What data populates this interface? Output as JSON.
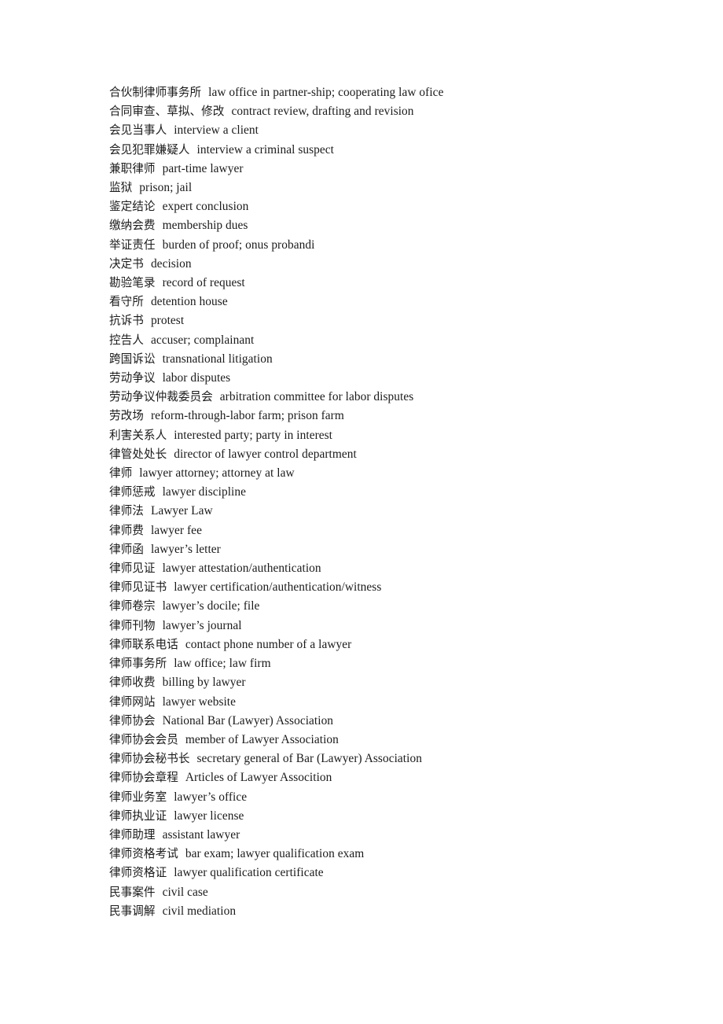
{
  "document": {
    "type": "bilingual-glossary",
    "language_pair": "Chinese-English",
    "subject": "legal terminology",
    "background_color": "#ffffff",
    "text_color": "#1b1b1b",
    "entry_count": 42
  },
  "entries": [
    {
      "term": "合伙制律师事务所",
      "gloss": "law office in partner-ship; cooperating law ofice"
    },
    {
      "term": "合同审查、草拟、修改",
      "gloss": "contract review, drafting and revision"
    },
    {
      "term": "会见当事人",
      "gloss": "interview a client"
    },
    {
      "term": "会见犯罪嫌疑人",
      "gloss": "interview a criminal suspect"
    },
    {
      "term": "兼职律师",
      "gloss": "part-time lawyer"
    },
    {
      "term": "监狱",
      "gloss": "prison; jail"
    },
    {
      "term": "鉴定结论",
      "gloss": "expert conclusion"
    },
    {
      "term": "缴纳会费",
      "gloss": "membership dues"
    },
    {
      "term": "举证责任",
      "gloss": "burden of proof; onus probandi"
    },
    {
      "term": "决定书",
      "gloss": "decision"
    },
    {
      "term": "勘验笔录",
      "gloss": "record of request"
    },
    {
      "term": "看守所",
      "gloss": "detention house"
    },
    {
      "term": "抗诉书",
      "gloss": "protest"
    },
    {
      "term": "控告人",
      "gloss": "accuser; complainant"
    },
    {
      "term": "跨国诉讼",
      "gloss": "transnational litigation"
    },
    {
      "term": "劳动争议",
      "gloss": "labor disputes"
    },
    {
      "term": "劳动争议仲裁委员会",
      "gloss": "arbitration committee for labor disputes"
    },
    {
      "term": "劳改场",
      "gloss": "reform-through-labor farm; prison farm"
    },
    {
      "term": "利害关系人",
      "gloss": "interested party; party in interest"
    },
    {
      "term": "律管处处长",
      "gloss": "director of lawyer control department"
    },
    {
      "term": "律师",
      "gloss": "lawyer attorney; attorney at law"
    },
    {
      "term": "律师惩戒",
      "gloss": "lawyer discipline"
    },
    {
      "term": "律师法",
      "gloss": "Lawyer Law"
    },
    {
      "term": "律师费",
      "gloss": "lawyer fee"
    },
    {
      "term": "律师函",
      "gloss": "lawyer’s letter"
    },
    {
      "term": "律师见证",
      "gloss": "lawyer attestation/authentication"
    },
    {
      "term": "律师见证书",
      "gloss": "lawyer certification/authentication/witness"
    },
    {
      "term": "律师卷宗",
      "gloss": "lawyer’s docile; file"
    },
    {
      "term": "律师刊物",
      "gloss": "lawyer’s journal"
    },
    {
      "term": "律师联系电话",
      "gloss": "contact phone number of a lawyer"
    },
    {
      "term": "律师事务所",
      "gloss": "law office; law firm"
    },
    {
      "term": "律师收费",
      "gloss": "billing by lawyer"
    },
    {
      "term": "律师网站",
      "gloss": "lawyer website"
    },
    {
      "term": "律师协会",
      "gloss": "National Bar (Lawyer) Association"
    },
    {
      "term": "律师协会会员",
      "gloss": "member of Lawyer Association"
    },
    {
      "term": "律师协会秘书长",
      "gloss": "secretary general of Bar (Lawyer) Association"
    },
    {
      "term": "律师协会章程",
      "gloss": "Articles of Lawyer Assocition"
    },
    {
      "term": "律师业务室",
      "gloss": "lawyer’s office"
    },
    {
      "term": "律师执业证",
      "gloss": "lawyer license"
    },
    {
      "term": "律师助理",
      "gloss": "assistant lawyer"
    },
    {
      "term": "律师资格考试",
      "gloss": "bar exam; lawyer qualification exam"
    },
    {
      "term": "律师资格证",
      "gloss": "lawyer qualification certificate"
    },
    {
      "term": "民事案件",
      "gloss": "civil case"
    },
    {
      "term": "民事调解",
      "gloss": "civil mediation"
    }
  ]
}
